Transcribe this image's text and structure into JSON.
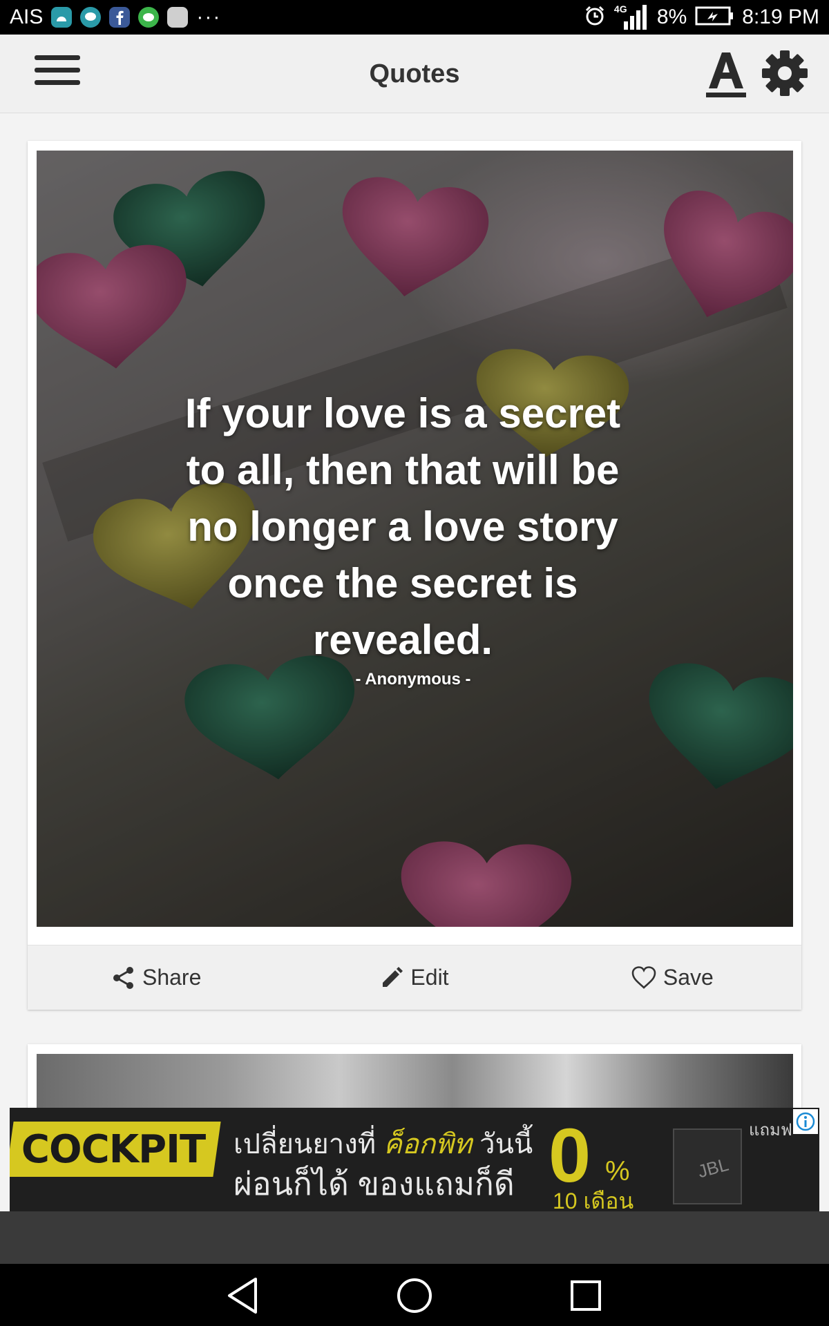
{
  "status_bar": {
    "carrier": "AIS",
    "network": "4G",
    "battery": "8%",
    "time": "8:19 PM",
    "overflow": "···",
    "notification_icons": [
      "android-icon",
      "message-icon",
      "facebook-icon",
      "line-icon",
      "app-icon"
    ]
  },
  "toolbar": {
    "title": "Quotes",
    "menu_icon": "hamburger-menu-icon",
    "font_icon": "font-size-icon",
    "settings_icon": "gear-icon"
  },
  "quote_card": {
    "text": "If your love is a secret to all, then that will be no longer a love story once the secret is revealed.",
    "author": "- Anonymous -",
    "actions": {
      "share": "Share",
      "edit": "Edit",
      "save": "Save"
    }
  },
  "ad": {
    "brand": "COCKPIT",
    "line1_prefix": "เปลี่ยนยางที่ ",
    "line1_highlight": "ค็อกพิท",
    "line1_suffix": " วันนี้",
    "line2": "ผ่อนก็ได้ ของแถมก็ดี",
    "rate": "0",
    "percent": "%",
    "months": "10 เดือน",
    "gift": "แถมฟ",
    "product": "JBL"
  },
  "colors": {
    "toolbar_bg": "#f0f0f0",
    "ad_accent": "#d6c820",
    "text_dark": "#333333"
  }
}
